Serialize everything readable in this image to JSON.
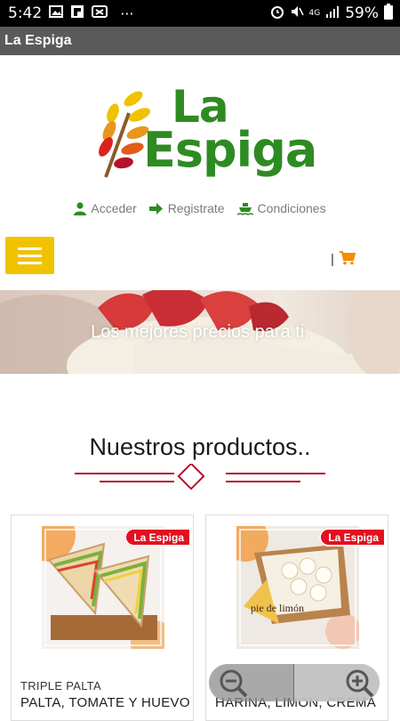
{
  "status_bar": {
    "time": "5:42",
    "more": "···",
    "network": "4G",
    "battery": "59%"
  },
  "app_bar": {
    "title": "La Espiga"
  },
  "logo": {
    "line1": "La",
    "line2": "Espiga"
  },
  "account_links": [
    {
      "label": "Acceder",
      "icon": "user-icon"
    },
    {
      "label": "Registrate",
      "icon": "arrow-right-icon"
    },
    {
      "label": "Condiciones",
      "icon": "ship-icon"
    }
  ],
  "nav": {
    "menu_icon": "hamburger-icon",
    "cart_divider": "|",
    "cart_icon": "cart-icon"
  },
  "hero": {
    "text": "Los mejores precios para ti."
  },
  "section": {
    "title": "Nuestros productos.."
  },
  "products": [
    {
      "badge": "La Espiga",
      "category": "TRIPLE PALTA",
      "name": "PALTA, TOMATE Y HUEVO"
    },
    {
      "badge": "La Espiga",
      "category": "",
      "name": "HARINA, LIMON, CREMA",
      "image_caption": "pie de limón"
    }
  ],
  "zoom": {
    "zoom_out_icon": "zoom-out-icon",
    "zoom_in_icon": "zoom-in-icon"
  },
  "colors": {
    "brand_green": "#2e8b22",
    "menu_yellow": "#f2c200",
    "cart_orange": "#f28c00",
    "divider_red": "#b5122b",
    "badge_red": "#e3101f"
  }
}
